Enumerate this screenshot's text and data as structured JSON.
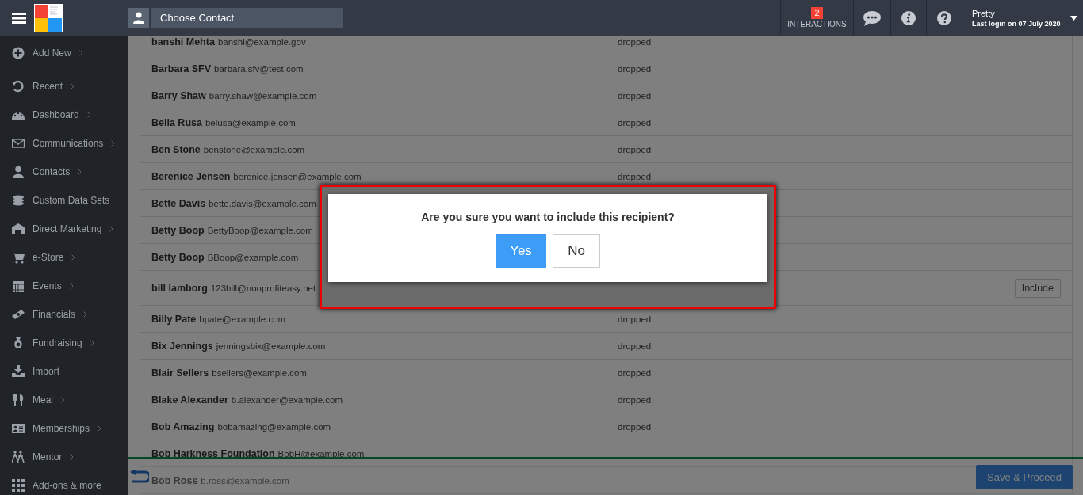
{
  "topbar": {
    "contact_chooser": {
      "placeholder": "Choose Contact"
    },
    "interactions": {
      "count": "2",
      "label": "INTERACTIONS"
    },
    "user": {
      "name": "Pretty",
      "last_login": "Last login on 07 July 2020"
    }
  },
  "sidebar": {
    "items": [
      {
        "label": "Add New",
        "has_submenu": true
      },
      {
        "label": "Recent",
        "has_submenu": true
      },
      {
        "label": "Dashboard",
        "has_submenu": true
      },
      {
        "label": "Communications",
        "has_submenu": true
      },
      {
        "label": "Contacts",
        "has_submenu": true
      },
      {
        "label": "Custom Data Sets",
        "has_submenu": false
      },
      {
        "label": "Direct Marketing",
        "has_submenu": true
      },
      {
        "label": "e-Store",
        "has_submenu": true
      },
      {
        "label": "Events",
        "has_submenu": true
      },
      {
        "label": "Financials",
        "has_submenu": true
      },
      {
        "label": "Fundraising",
        "has_submenu": true
      },
      {
        "label": "Import",
        "has_submenu": false
      },
      {
        "label": "Meal",
        "has_submenu": true
      },
      {
        "label": "Memberships",
        "has_submenu": true
      },
      {
        "label": "Mentor",
        "has_submenu": true
      },
      {
        "label": "Add-ons & more",
        "has_submenu": false
      }
    ]
  },
  "recipients": [
    {
      "name": "banshi Mehta",
      "email": "banshi@example.gov",
      "status": "dropped"
    },
    {
      "name": "Barbara SFV",
      "email": "barbara.sfv@test.com",
      "status": "dropped"
    },
    {
      "name": "Barry Shaw",
      "email": "barry.shaw@example.com",
      "status": "dropped"
    },
    {
      "name": "Bella Rusa",
      "email": "belusa@example.com",
      "status": "dropped"
    },
    {
      "name": "Ben Stone",
      "email": "benstone@example.com",
      "status": "dropped"
    },
    {
      "name": "Berenice Jensen",
      "email": "berenice.jensen@example.com",
      "status": "dropped"
    },
    {
      "name": "Bette Davis",
      "email": "bette.davis@example.com"
    },
    {
      "name": "Betty Boop",
      "email": "BettyBoop@example.com"
    },
    {
      "name": "Betty Boop",
      "email": "BBoop@example.com"
    },
    {
      "name": "bill lamborg",
      "email": "123bill@nonprofiteasy.net",
      "action": "Include"
    },
    {
      "name": "Billy Pate",
      "email": "bpate@example.com",
      "status": "dropped"
    },
    {
      "name": "Bix Jennings",
      "email": "jenningsbix@example.com",
      "status": "dropped"
    },
    {
      "name": "Blair Sellers",
      "email": "bsellers@example.com",
      "status": "dropped"
    },
    {
      "name": "Blake Alexander",
      "email": "b.alexander@example.com",
      "status": "dropped"
    },
    {
      "name": "Bob Amazing",
      "email": "bobamazing@example.com",
      "status": "dropped"
    },
    {
      "name": "Bob Harkness Foundation",
      "email": "BobH@example.com"
    },
    {
      "name": "Bob Ross",
      "email": "b.ross@example.com"
    }
  ],
  "footer": {
    "save_button": "Save & Proceed"
  },
  "dialog": {
    "question": "Are you sure you want to include this recipient?",
    "buttons": [
      {
        "label": "Yes",
        "primary": true
      },
      {
        "label": "No",
        "primary": false
      }
    ]
  }
}
